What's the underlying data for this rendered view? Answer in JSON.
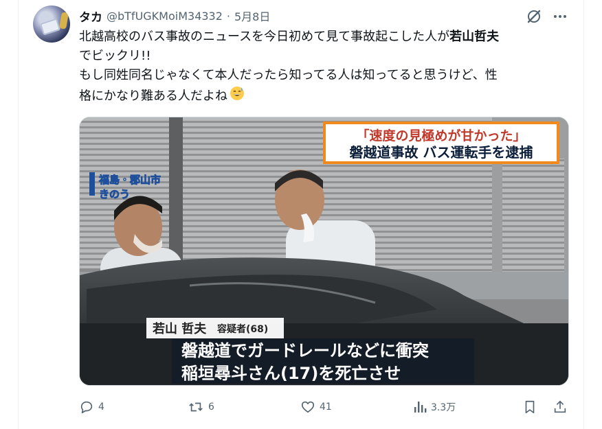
{
  "tweet": {
    "display_name": "タカ",
    "handle": "@bTfUGKMoiM34332",
    "separator": "·",
    "date": "5月8日",
    "text_line1": "北越高校のバス事故のニュースを今日初めて見て事故起こした人が",
    "text_line1_bold": "若山哲夫",
    "text_line2": "でビックリ!!",
    "text_line3": "もし同姓同名じゃなくて本人だったら知ってる人は知ってると思うけど、性",
    "text_line4": "格にかなり難ある人だよね",
    "emoji_icon": "grinning-sweat-emoji"
  },
  "media": {
    "top_caption_line1": "「速度の見極めが甘かった」",
    "top_caption_line2": "磐越道事故 バス運転手を逮捕",
    "location_line1": "福島・郡山市",
    "location_line2": "きのう",
    "name_tag_name": "若山 哲夫",
    "name_tag_role": "容疑者(68)",
    "bottom_caption_line1": "磐越道でガードレールなどに衝突",
    "bottom_caption_line2": "稲垣尋斗さん(17)を死亡させ"
  },
  "actions": {
    "reply_count": "4",
    "retweet_count": "6",
    "like_count": "41",
    "views_count": "3.3万"
  },
  "icons": {
    "header": [
      "grok-icon",
      "more-icon"
    ],
    "actions": [
      "reply-icon",
      "retweet-icon",
      "like-icon",
      "views-icon",
      "bookmark-icon",
      "share-icon"
    ]
  },
  "colors": {
    "text_primary": "#0f1419",
    "text_secondary": "#536471",
    "caption_orange": "#f08a1c",
    "caption_dark": "#0b1f3a",
    "caption_red": "#c0392b"
  }
}
